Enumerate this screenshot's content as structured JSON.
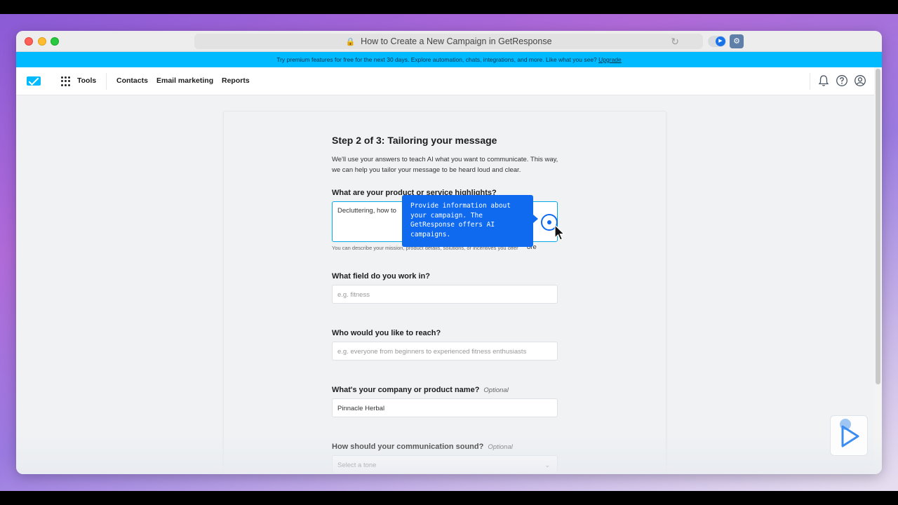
{
  "browser": {
    "url_title": "How to Create a New Campaign in GetResponse"
  },
  "promo_banner": {
    "text": "Try premium features for free for the next 30 days. Explore automation, chats, integrations, and more. Like what you see?",
    "link": "Upgrade"
  },
  "nav": {
    "tools": "Tools",
    "items": [
      "Contacts",
      "Email marketing",
      "Reports"
    ]
  },
  "form": {
    "step_title": "Step 2 of 3: Tailoring your message",
    "intro": "We'll use your answers to teach AI what you want to communicate. This way, we can help you tailor your message to be heard loud and clear.",
    "highlights": {
      "label": "What are your product or service highlights?",
      "value": "Decluttering, how to",
      "value_tail": "ore",
      "help": "You can describe your mission, product details, solutions, or incentives you offer"
    },
    "field": {
      "label": "What field do you work in?",
      "placeholder": "e.g. fitness"
    },
    "reach": {
      "label": "Who would you like to reach?",
      "placeholder": "e.g. everyone from beginners to experienced fitness enthusiasts"
    },
    "company": {
      "label": "What's your company or product name?",
      "optional": "Optional",
      "value": "Pinnacle Herbal"
    },
    "tone": {
      "label": "How should your communication sound?",
      "optional": "Optional",
      "value": "Select a tone"
    }
  },
  "tooltip": {
    "text": "Provide information about your campaign. The GetResponse offers AI campaigns."
  },
  "colors": {
    "brand": "#00baff",
    "tooltip": "#0f6af0"
  }
}
